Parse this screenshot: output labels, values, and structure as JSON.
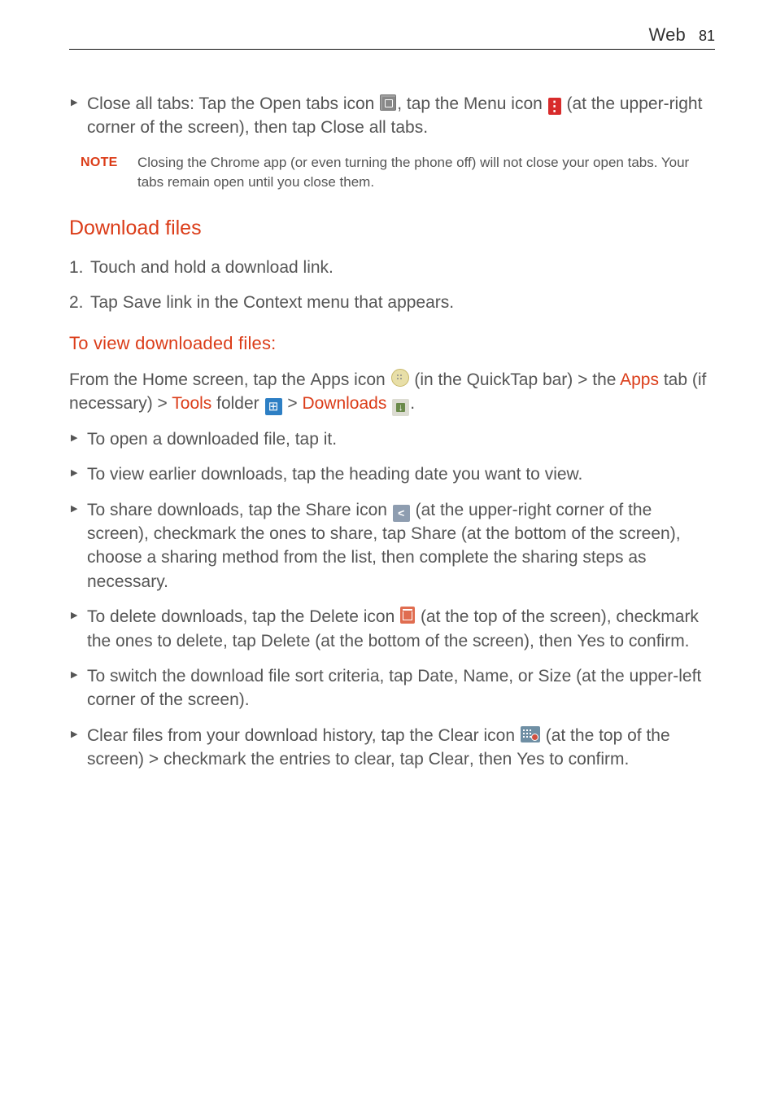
{
  "header": {
    "section_label": "Web",
    "page_number": "81"
  },
  "bullet1": {
    "b1": "Close all tabs",
    "t1": ": Tap the ",
    "b2": "Open tabs",
    "t2": " icon ",
    "t3": ", tap the ",
    "b3": "Menu",
    "t4": " icon ",
    "t5": " (at the upper-right corner of the screen), then tap ",
    "b4": "Close all tabs",
    "t6": "."
  },
  "note": {
    "label": "NOTE",
    "text": "Closing the Chrome app (or even turning the phone off) will not close your open tabs. Your tabs remain open until you close them."
  },
  "h2_download": "Download files",
  "step1": "Touch and hold a download link.",
  "step2": {
    "t1": "Tap ",
    "b1": "Save link",
    "t2": " in the Context menu that appears."
  },
  "h3_view": "To view downloaded files:",
  "intro": {
    "t1": "From the Home screen, tap the ",
    "b1": "Apps",
    "t2": " icon ",
    "t3": " (in the QuickTap bar) > the ",
    "a1": "Apps",
    "t4": " tab (if necessary) > ",
    "a2": "Tools",
    "t5": " folder ",
    "t6": " > ",
    "a3": "Downloads",
    "t7": " ",
    "t8": "."
  },
  "view_b1": "To open a downloaded file, tap it.",
  "view_b2": "To view earlier downloads, tap the heading date you want to view.",
  "view_b3": {
    "t1": "To share downloads, tap the ",
    "b1": "Share",
    "t2": " icon ",
    "t3": " (at the upper-right corner of the screen), checkmark the ones to share, tap ",
    "b2": "Share",
    "t4": " (at the bottom of the screen), choose a sharing method from the list, then complete the sharing steps as necessary."
  },
  "view_b4": {
    "t1": "To delete downloads, tap the ",
    "b1": "Delete",
    "t2": " icon ",
    "t3": " (at the top of the screen), checkmark the ones to delete, tap ",
    "b2": "Delete",
    "t4": " (at the bottom of the screen), then ",
    "b3": "Yes",
    "t5": " to confirm."
  },
  "view_b5": {
    "t1": "To switch the download file sort criteria, tap ",
    "b1": "Date",
    "t2": ", ",
    "b2": "Name",
    "t3": ", or ",
    "b3": "Size",
    "t4": " (at the upper-left corner of the screen)."
  },
  "view_b6": {
    "t1": "Clear files from your download history, tap the ",
    "b1": "Clear",
    "t2": " icon ",
    "t3": " (at the top of the screen) > checkmark the entries to clear, tap ",
    "b2": "Clear",
    "t4": ", then ",
    "b3": "Yes",
    "t5": " to confirm."
  }
}
